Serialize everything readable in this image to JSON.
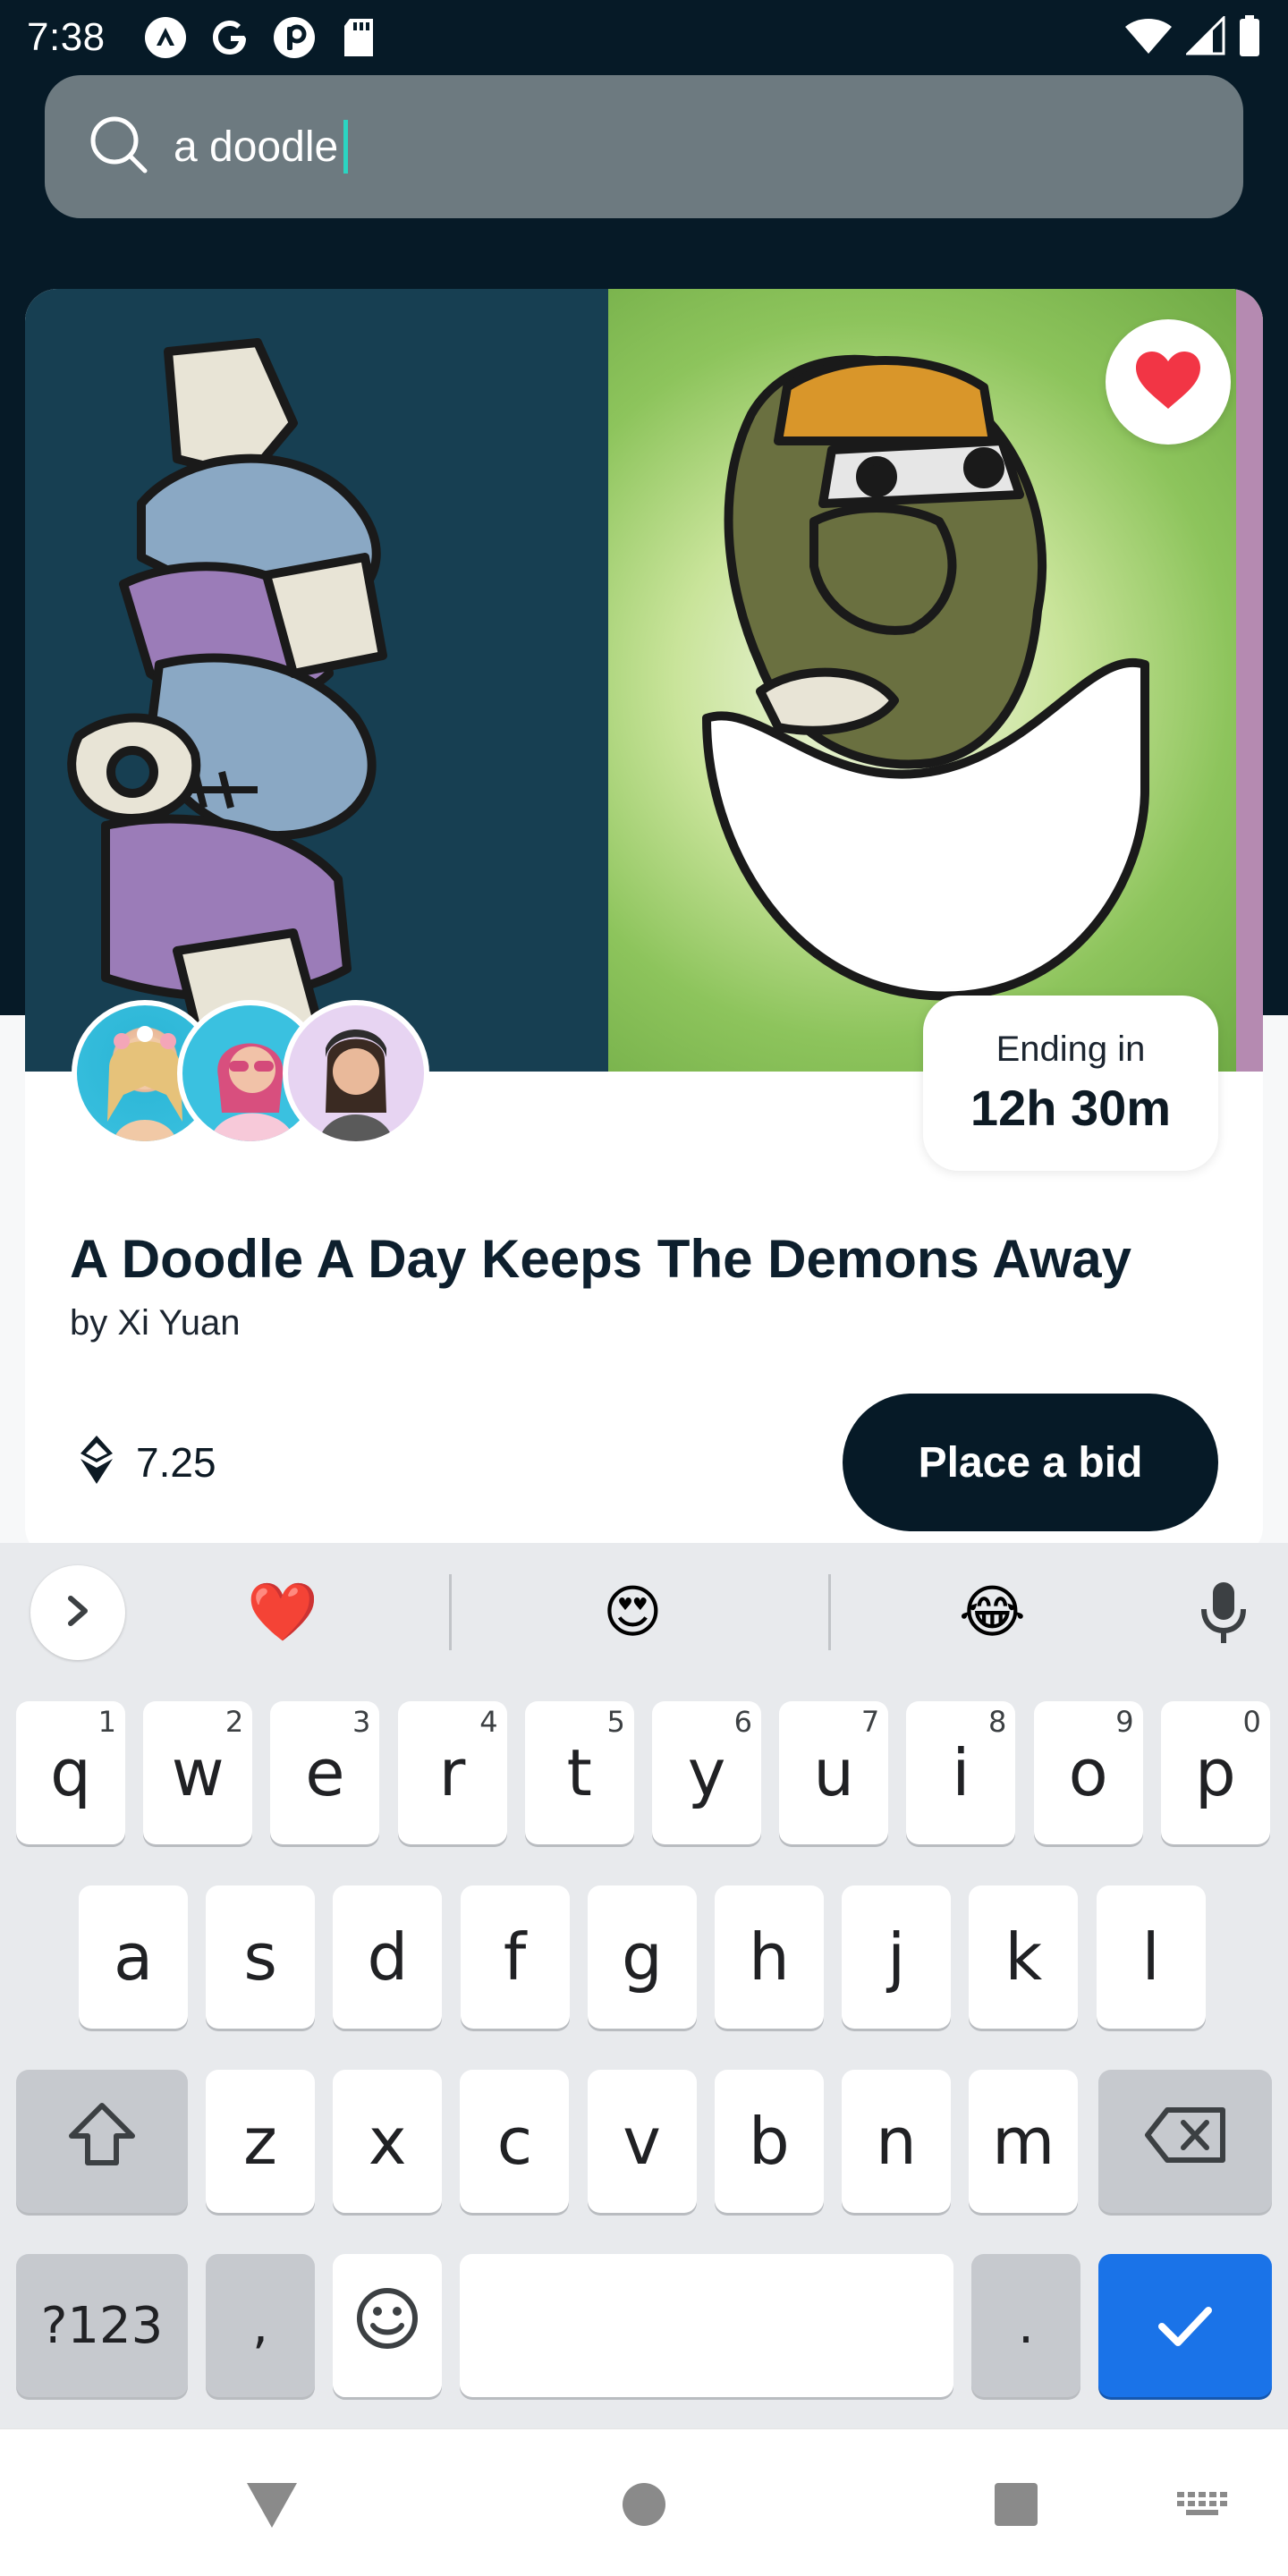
{
  "status_bar": {
    "time": "7:38",
    "left_icons": [
      "nomad-icon",
      "google-icon",
      "pinterest-icon",
      "sd-card-icon"
    ],
    "right_icons": [
      "wifi-icon",
      "signal-icon",
      "battery-icon"
    ]
  },
  "search": {
    "query": "a doodle"
  },
  "card": {
    "title": "A Doodle A Day Keeps The Demons Away",
    "author": "by Xi Yuan",
    "ending_label": "Ending in",
    "ending_time": "12h 30m",
    "price": "7.25",
    "bid_label": "Place a bid",
    "favorite": true,
    "colors": {
      "accent": "#061a27",
      "heart": "#f23545"
    }
  },
  "keyboard": {
    "suggestions": [
      "❤️",
      "😍",
      "😂"
    ],
    "row1": [
      {
        "k": "q",
        "h": "1"
      },
      {
        "k": "w",
        "h": "2"
      },
      {
        "k": "e",
        "h": "3"
      },
      {
        "k": "r",
        "h": "4"
      },
      {
        "k": "t",
        "h": "5"
      },
      {
        "k": "y",
        "h": "6"
      },
      {
        "k": "u",
        "h": "7"
      },
      {
        "k": "i",
        "h": "8"
      },
      {
        "k": "o",
        "h": "9"
      },
      {
        "k": "p",
        "h": "0"
      }
    ],
    "row2": [
      "a",
      "s",
      "d",
      "f",
      "g",
      "h",
      "j",
      "k",
      "l"
    ],
    "row3": [
      "z",
      "x",
      "c",
      "v",
      "b",
      "n",
      "m"
    ],
    "symbols_label": "?123",
    "comma_label": ",",
    "period_label": "."
  },
  "nav_bar": {
    "icons": [
      "back-icon",
      "home-icon",
      "recents-icon",
      "keyboard-switch-icon"
    ]
  }
}
